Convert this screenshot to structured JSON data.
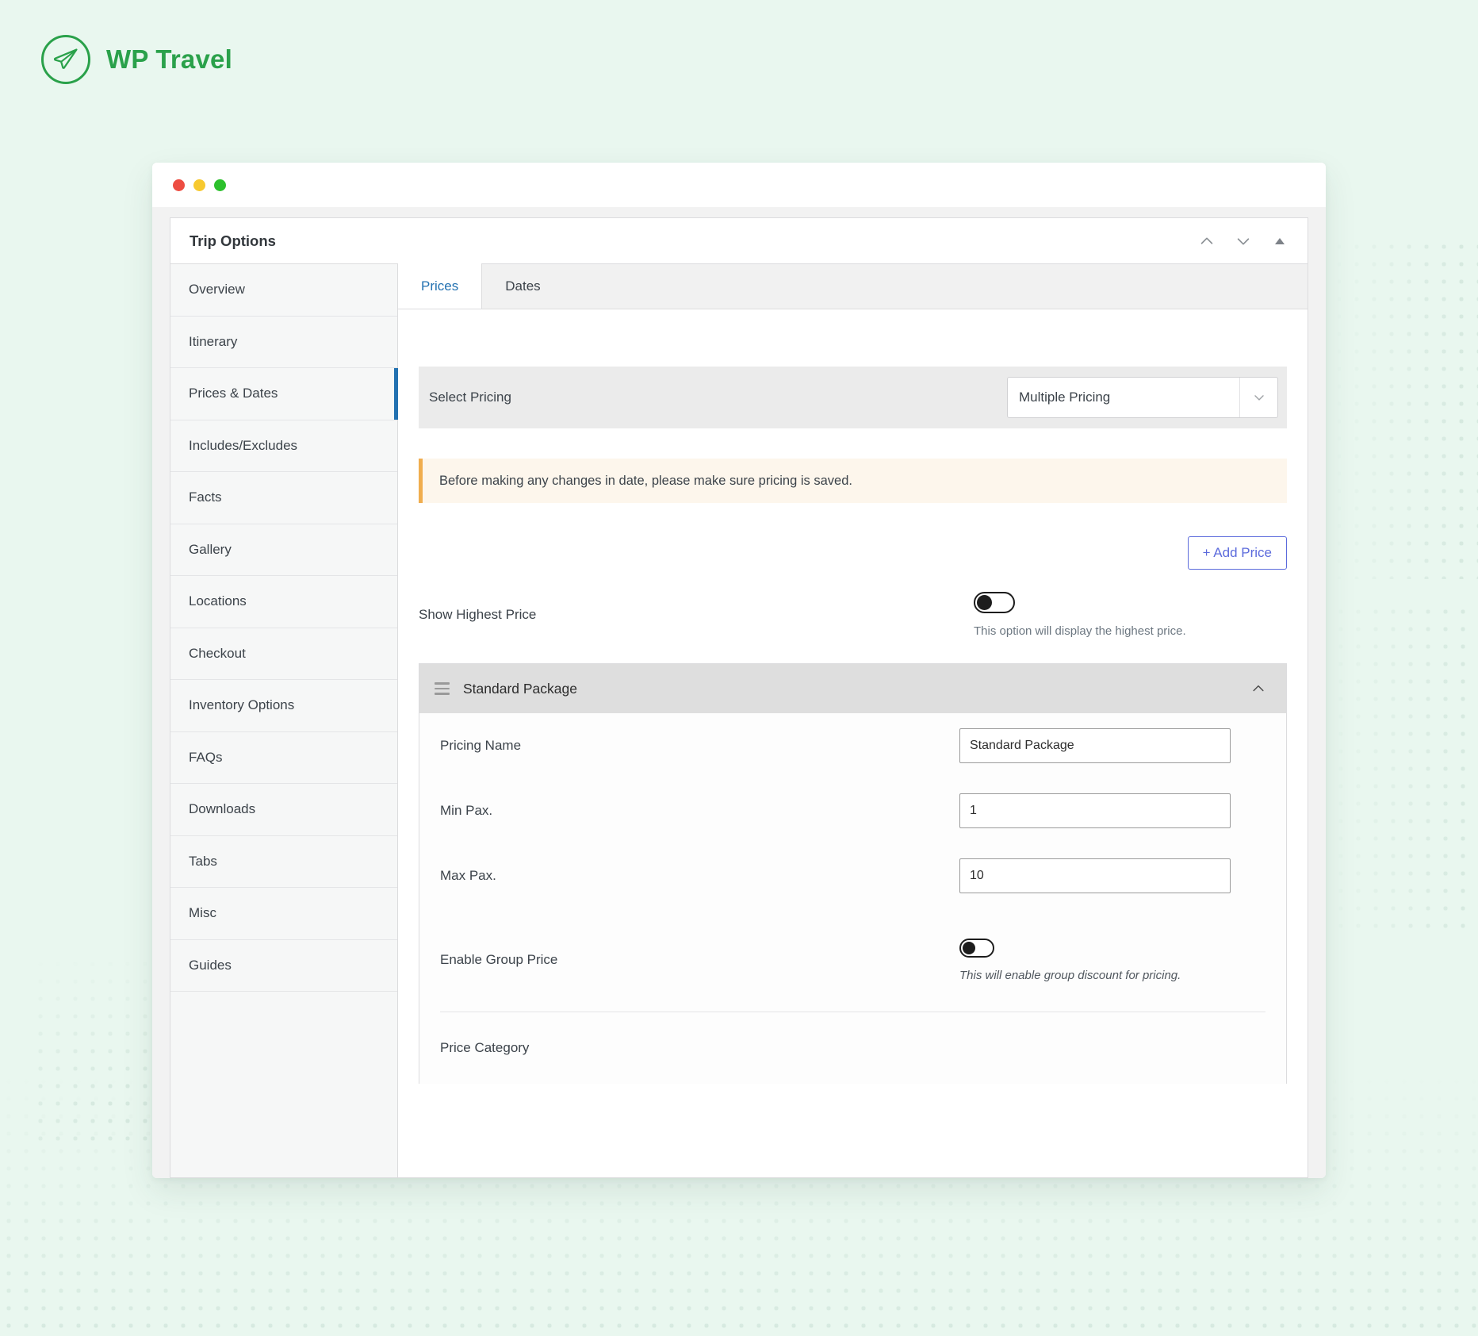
{
  "brand": {
    "name": "WP Travel",
    "logo_icon": "paper-plane-icon",
    "color": "#2aa14a"
  },
  "window": {
    "traffic_lights": [
      {
        "name": "close",
        "color": "#ed4d42"
      },
      {
        "name": "minimize",
        "color": "#f7c92f"
      },
      {
        "name": "maximize",
        "color": "#2cc02c"
      }
    ]
  },
  "panel": {
    "title": "Trip Options",
    "actions": [
      {
        "name": "move-up",
        "icon": "chevron-up-icon"
      },
      {
        "name": "move-down",
        "icon": "chevron-down-icon"
      },
      {
        "name": "collapse",
        "icon": "triangle-up-icon"
      }
    ]
  },
  "sidebar": {
    "items": [
      {
        "label": "Overview",
        "active": false
      },
      {
        "label": "Itinerary",
        "active": false
      },
      {
        "label": "Prices & Dates",
        "active": true
      },
      {
        "label": "Includes/Excludes",
        "active": false
      },
      {
        "label": "Facts",
        "active": false
      },
      {
        "label": "Gallery",
        "active": false
      },
      {
        "label": "Locations",
        "active": false
      },
      {
        "label": "Checkout",
        "active": false
      },
      {
        "label": "Inventory Options",
        "active": false
      },
      {
        "label": "FAQs",
        "active": false
      },
      {
        "label": "Downloads",
        "active": false
      },
      {
        "label": "Tabs",
        "active": false
      },
      {
        "label": "Misc",
        "active": false
      },
      {
        "label": "Guides",
        "active": false
      }
    ],
    "active_accent": "#2271b1"
  },
  "tabs": [
    {
      "label": "Prices",
      "active": true
    },
    {
      "label": "Dates",
      "active": false
    }
  ],
  "pricing": {
    "select_label": "Select Pricing",
    "select_value": "Multiple Pricing",
    "select_icon": "chevron-down-icon"
  },
  "notice": {
    "text": "Before making any changes in date, please make sure pricing is saved.",
    "accent": "#f0ad4e",
    "background": "#fdf6ec"
  },
  "add_price": {
    "label": "+ Add Price",
    "color": "#5c6bdc"
  },
  "show_highest_price": {
    "label": "Show Highest Price",
    "help": "This option will display the highest price.",
    "state": "off"
  },
  "package": {
    "title": "Standard Package",
    "drag_icon": "drag-handle-icon",
    "collapse_icon": "chevron-up-icon",
    "fields": [
      {
        "label": "Pricing Name",
        "value": "Standard Package",
        "type": "text"
      },
      {
        "label": "Min Pax.",
        "value": "1",
        "type": "text"
      },
      {
        "label": "Max Pax.",
        "value": "10",
        "type": "text"
      }
    ],
    "group_price": {
      "label": "Enable Group Price",
      "help": "This will enable group discount for pricing.",
      "state": "off"
    },
    "price_category_label": "Price Category"
  }
}
